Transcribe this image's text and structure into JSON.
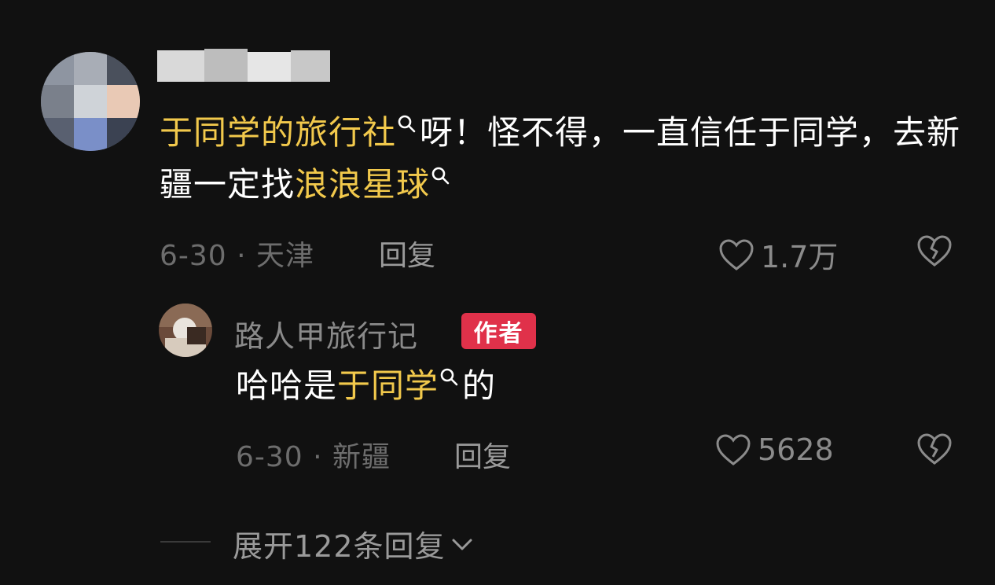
{
  "comment": {
    "text": {
      "kw1": "于同学的旅行社",
      "part1": "呀！怪不得，一直信任于同学，去新疆一定找",
      "kw2": "浪浪星球"
    },
    "meta": "6-30 · 天津",
    "reply_label": "回复",
    "likes": "1.7万"
  },
  "reply": {
    "author_name": "路人甲旅行记",
    "badge": "作者",
    "text": {
      "part1": "哈哈是",
      "kw1": "于同学",
      "part2": "的"
    },
    "meta": "6-30 · 新疆",
    "reply_label": "回复",
    "likes": "5628"
  },
  "expand": {
    "label": "展开122条回复"
  },
  "colors": {
    "background": "#111111",
    "keyword": "#f2c94c",
    "badge": "#e0314a",
    "meta": "#6d6d6d"
  },
  "icons": [
    "search-icon",
    "heart-icon",
    "broken-heart-icon",
    "chevron-down-icon"
  ]
}
